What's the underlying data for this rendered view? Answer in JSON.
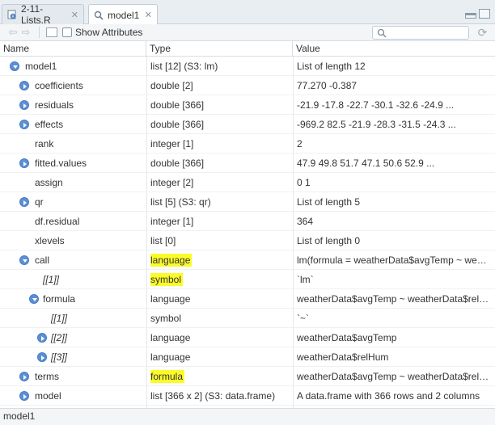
{
  "tabs": [
    {
      "label": "2-11-Lists.R",
      "icon": "r-script-icon",
      "active": false
    },
    {
      "label": "model1",
      "icon": "magnifier-icon",
      "active": true
    }
  ],
  "toolbar": {
    "show_attributes_label": "Show Attributes",
    "search_placeholder": ""
  },
  "columns": {
    "name": "Name",
    "type": "Type",
    "value": "Value"
  },
  "rows": [
    {
      "name": "model1",
      "type": "list [12] (S3: lm)",
      "value": "List of length 12",
      "indent": 0,
      "toggle": "expanded",
      "italic": false,
      "highlight": false
    },
    {
      "name": "coefficients",
      "type": "double [2]",
      "value": "77.270 -0.387",
      "indent": 1,
      "toggle": "collapsed",
      "italic": false,
      "highlight": false
    },
    {
      "name": "residuals",
      "type": "double [366]",
      "value": "-21.9 -17.8 -22.7 -30.1 -32.6 -24.9 ...",
      "indent": 1,
      "toggle": "collapsed",
      "italic": false,
      "highlight": false
    },
    {
      "name": "effects",
      "type": "double [366]",
      "value": "-969.2 82.5 -21.9 -28.3 -31.5 -24.3 ...",
      "indent": 1,
      "toggle": "collapsed",
      "italic": false,
      "highlight": false
    },
    {
      "name": "rank",
      "type": "integer [1]",
      "value": "2",
      "indent": 1,
      "toggle": "none",
      "italic": false,
      "highlight": false
    },
    {
      "name": "fitted.values",
      "type": "double [366]",
      "value": "47.9 49.8 51.7 47.1 50.6 52.9 ...",
      "indent": 1,
      "toggle": "collapsed",
      "italic": false,
      "highlight": false
    },
    {
      "name": "assign",
      "type": "integer [2]",
      "value": "0 1",
      "indent": 1,
      "toggle": "none",
      "italic": false,
      "highlight": false
    },
    {
      "name": "qr",
      "type": "list [5] (S3: qr)",
      "value": "List of length 5",
      "indent": 1,
      "toggle": "collapsed",
      "italic": false,
      "highlight": false
    },
    {
      "name": "df.residual",
      "type": "integer [1]",
      "value": "364",
      "indent": 1,
      "toggle": "none",
      "italic": false,
      "highlight": false
    },
    {
      "name": "xlevels",
      "type": "list [0]",
      "value": "List of length 0",
      "indent": 1,
      "toggle": "none",
      "italic": false,
      "highlight": false
    },
    {
      "name": "call",
      "type": "language",
      "value": "lm(formula = weatherData$avgTemp ~ weatherData$relHum)",
      "indent": 1,
      "toggle": "expanded",
      "italic": false,
      "highlight": true
    },
    {
      "name": "[[1]]",
      "type": "symbol",
      "value": "`lm`",
      "indent": 2,
      "toggle": "none",
      "italic": true,
      "highlight": true
    },
    {
      "name": "formula",
      "type": "language",
      "value": "weatherData$avgTemp ~ weatherData$relHum",
      "indent": 2,
      "toggle": "expanded",
      "italic": false,
      "highlight": false
    },
    {
      "name": "[[1]]",
      "type": "symbol",
      "value": "`~`",
      "indent": 3,
      "toggle": "none",
      "italic": true,
      "highlight": false
    },
    {
      "name": "[[2]]",
      "type": "language",
      "value": "weatherData$avgTemp",
      "indent": 3,
      "toggle": "collapsed",
      "italic": true,
      "highlight": false
    },
    {
      "name": "[[3]]",
      "type": "language",
      "value": "weatherData$relHum",
      "indent": 3,
      "toggle": "collapsed",
      "italic": true,
      "highlight": false
    },
    {
      "name": "terms",
      "type": "formula",
      "value": "weatherData$avgTemp ~ weatherData$relHum",
      "indent": 1,
      "toggle": "collapsed",
      "italic": false,
      "highlight": true
    },
    {
      "name": "model",
      "type": "list [366 x 2] (S3: data.frame)",
      "value": "A data.frame with 366 rows and 2 columns",
      "indent": 1,
      "toggle": "collapsed",
      "italic": false,
      "highlight": false
    }
  ],
  "status": {
    "path": "model1"
  },
  "colors": {
    "toggle": "#5b8fd6",
    "highlight": "#fbfb2a"
  }
}
